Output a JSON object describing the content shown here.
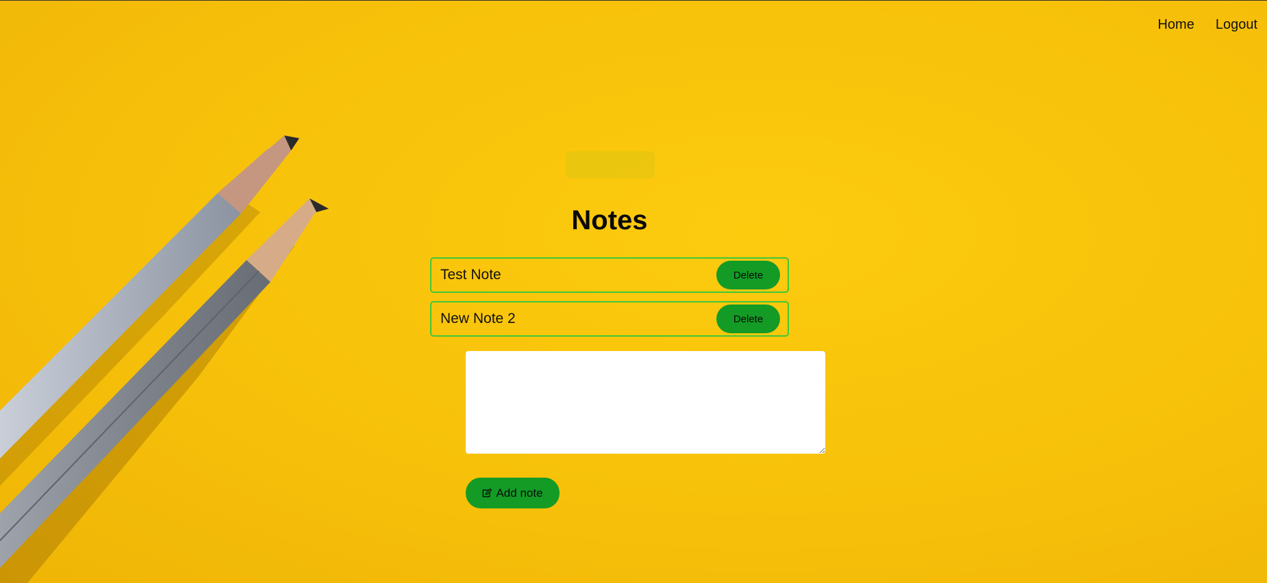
{
  "nav": {
    "home_label": "Home",
    "logout_label": "Logout"
  },
  "page": {
    "title": "Notes"
  },
  "notes": [
    {
      "text": "Test Note",
      "delete_label": "Delete"
    },
    {
      "text": "New Note 2",
      "delete_label": "Delete"
    }
  ],
  "composer": {
    "value": "",
    "placeholder": "",
    "add_label": "Add note",
    "add_icon": "edit-icon"
  },
  "colors": {
    "background": "#f7c10a",
    "button": "#139b26",
    "note_border": "#3ec73a"
  }
}
